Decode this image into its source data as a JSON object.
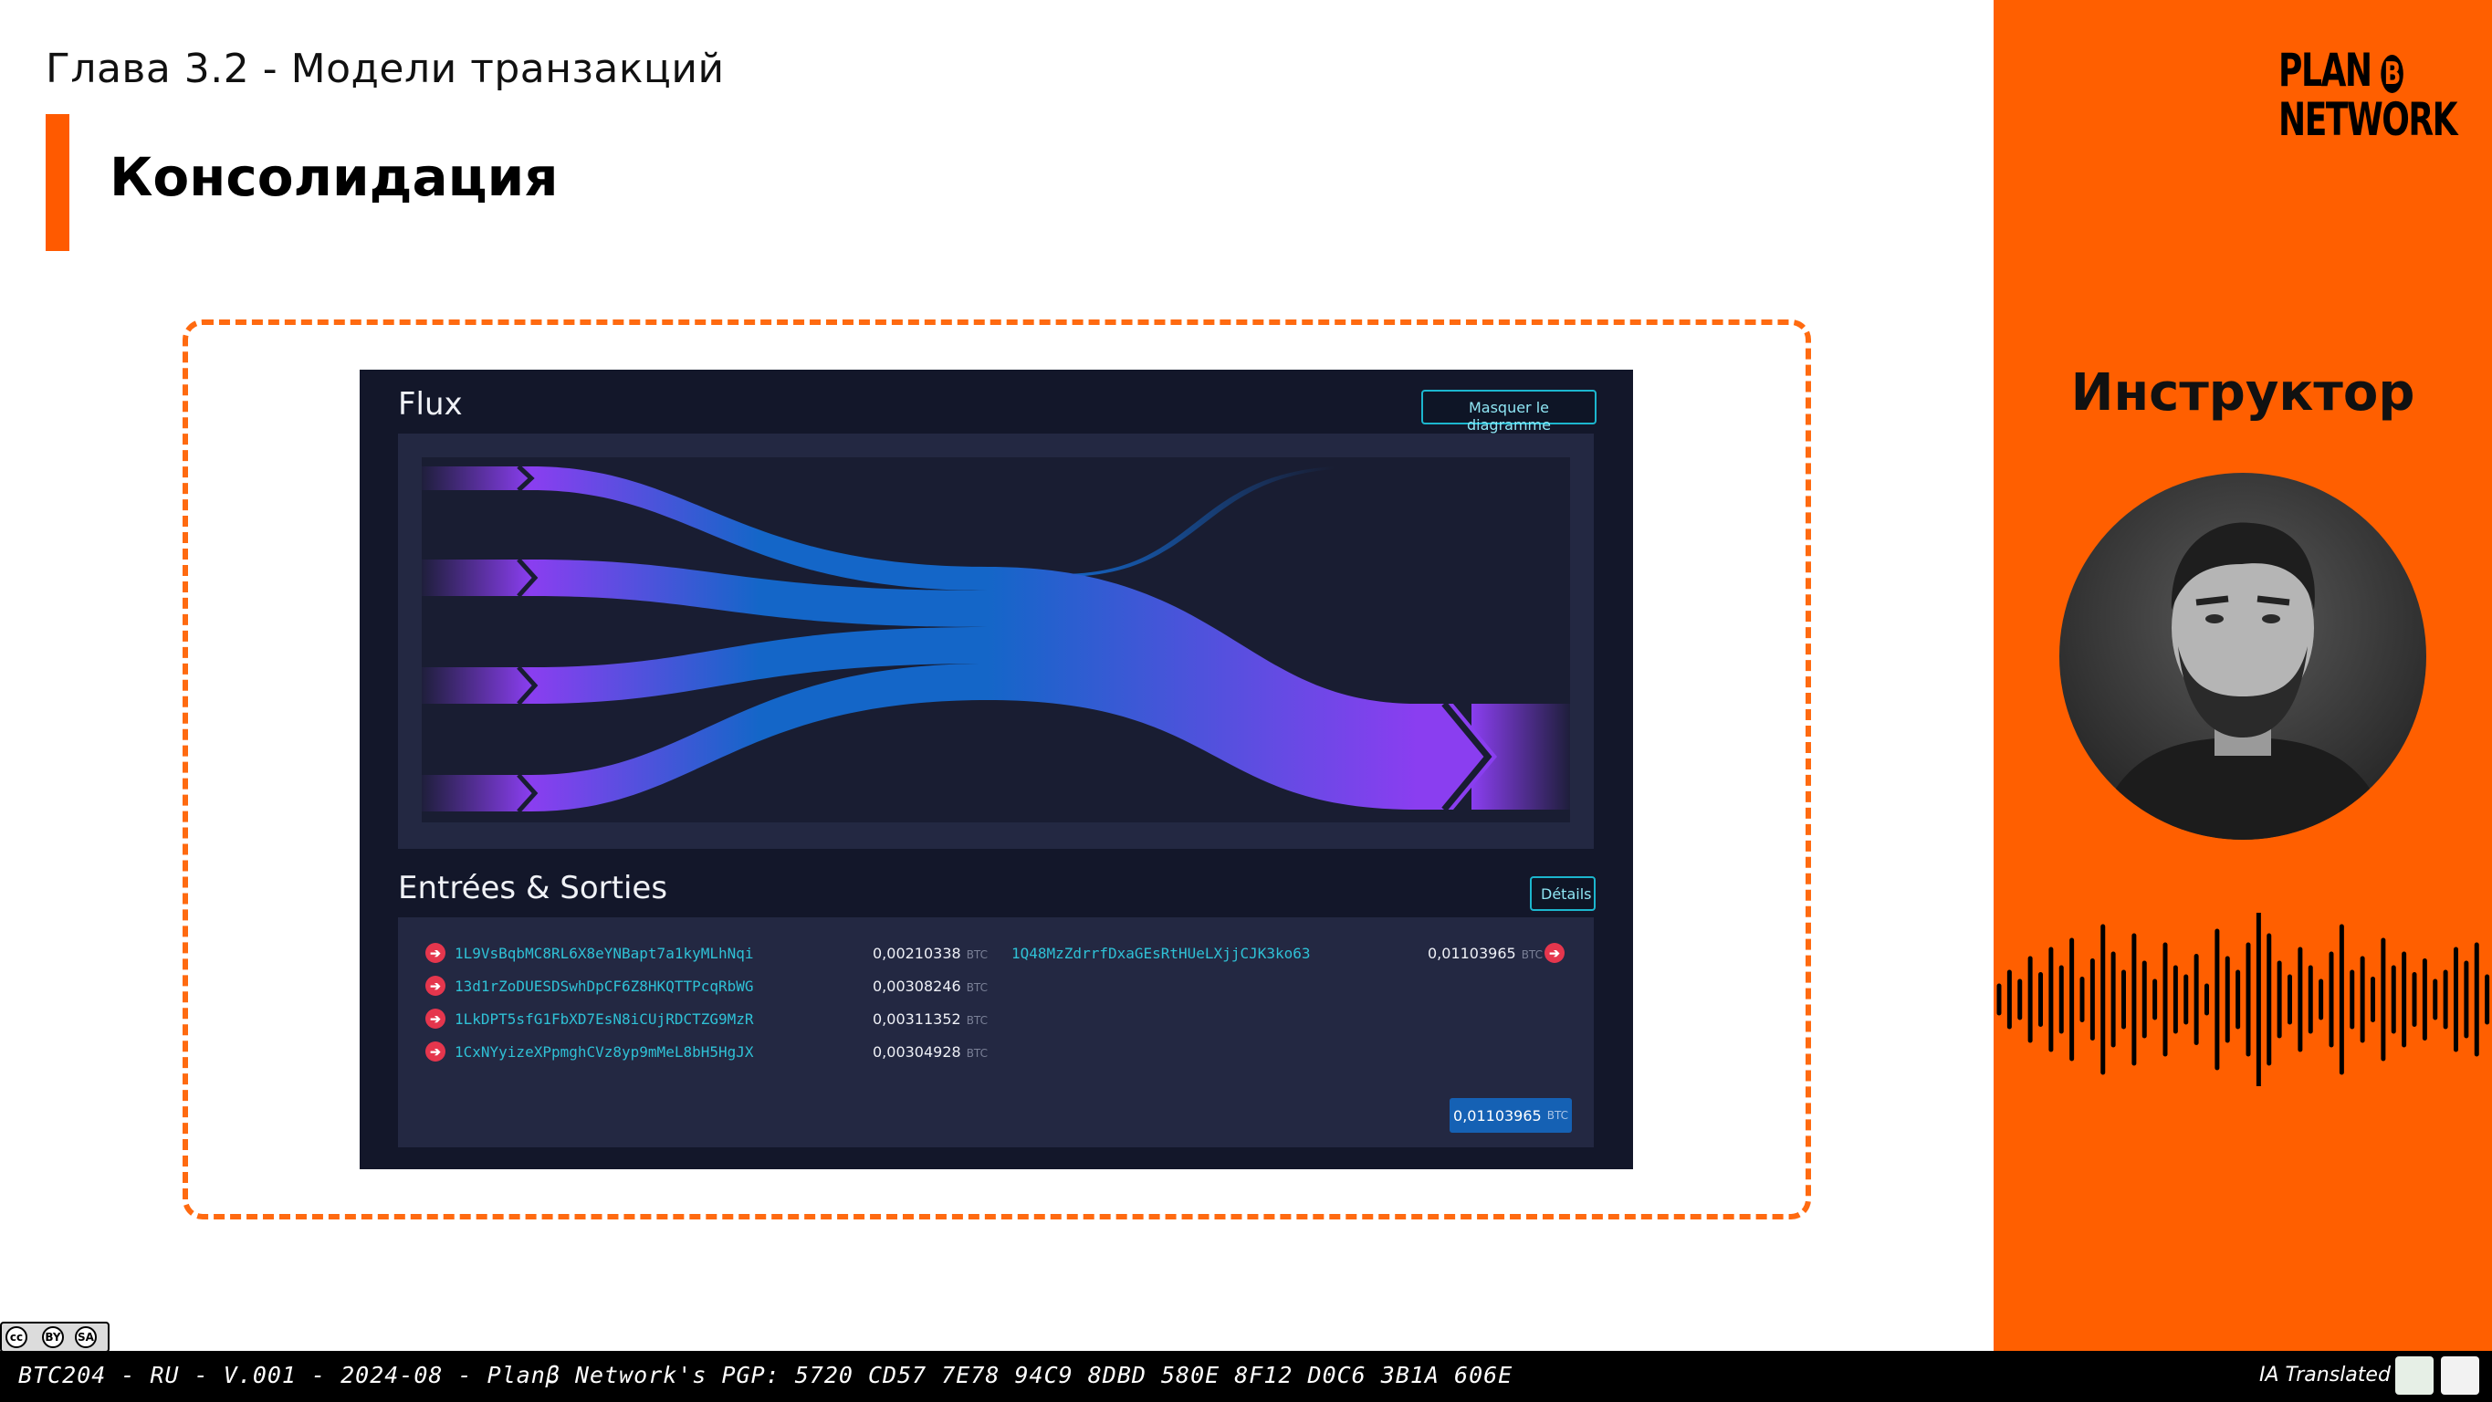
{
  "slide": {
    "chapter": "Глава 3.2 - Модели транзакций",
    "title": "Консолидация"
  },
  "app": {
    "flux_title": "Flux",
    "hide_diagram_label": "Masquer le diagramme",
    "io_title": "Entrées & Sorties",
    "details_label": "Détails",
    "unit": "BTC",
    "inputs": [
      {
        "address": "1L9VsBqbMC8RL6X8eYNBapt7a1kyMLhNqi",
        "amount": "0,00210338"
      },
      {
        "address": "13d1rZoDUESDSwhDpCF6Z8HKQTTPcqRbWG",
        "amount": "0,00308246"
      },
      {
        "address": "1LkDPT5sfG1FbXD7EsN8iCUjRDCTZG9MzR",
        "amount": "0,00311352"
      },
      {
        "address": "1CxNYyizeXPpmghCVz8yp9mMeL8bH5HgJX",
        "amount": "0,00304928"
      }
    ],
    "outputs": [
      {
        "address": "1Q48MzZdrrfDxaGEsRtHUeLXjjCJK3ko63",
        "amount": "0,01103965"
      }
    ],
    "total": "0,01103965"
  },
  "sidebar": {
    "logo_line1": "PLAN",
    "logo_b": "B",
    "logo_line2": "NETWORK",
    "instructor_label": "Инструктор"
  },
  "footer": {
    "meta": "BTC204 - RU - V.001 - 2024-08 - Planβ Network's PGP: 5720 CD57 7E78 94C9 8DBD 580E 8F12 D0C6 3B1A 606E",
    "ia_label": "IA Translated",
    "license_marks": [
      "cc",
      "BY",
      "SA"
    ]
  },
  "colors": {
    "accent": "#ff5f00",
    "app_bg": "#13172a",
    "panel_bg": "#232842",
    "link": "#2fc1d6",
    "flow_start": "#8a3ef0",
    "flow_mid": "#1466c8",
    "input_icon": "#e5364d",
    "total_button": "#1561b4"
  }
}
